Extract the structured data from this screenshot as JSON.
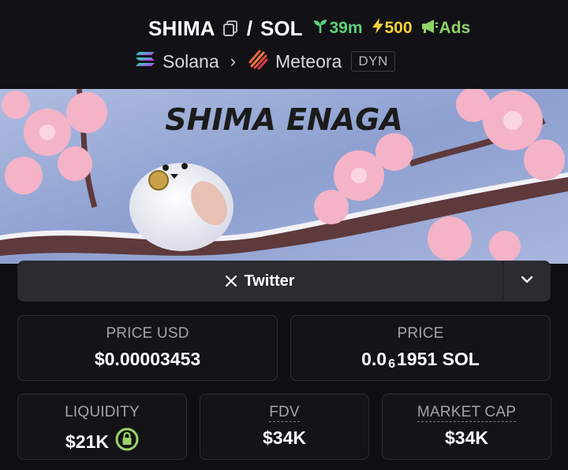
{
  "pair": {
    "base": "SHIMA",
    "separator": "/",
    "quote": "SOL",
    "age": "39m",
    "boosts": "500",
    "ads_label": "Ads"
  },
  "breadcrumb": {
    "chain": "Solana",
    "dex": "Meteora",
    "pool_type": "DYN"
  },
  "banner": {
    "title": "SHIMA ENAGA"
  },
  "socials": {
    "twitter_label": "Twitter"
  },
  "stats": {
    "price_usd_label": "PRICE USD",
    "price_usd_value": "$0.00003453",
    "price_label": "PRICE",
    "price_prefix": "0.0",
    "price_zeros": "6",
    "price_digits": "1951 SOL",
    "liquidity_label": "LIQUIDITY",
    "liquidity_value": "$21K",
    "fdv_label": "FDV",
    "fdv_value": "$34K",
    "mcap_label": "MARKET CAP",
    "mcap_value": "$34K"
  },
  "colors": {
    "background": "#0f0f13",
    "card": "#141418",
    "age_green": "#5fd07a",
    "boost_yellow": "#f5d23d",
    "ads_green": "#8fd36a",
    "lock_green": "#9bd46a"
  },
  "icons": [
    "copy-icon",
    "seedling-icon",
    "bolt-icon",
    "megaphone-icon",
    "solana-icon",
    "chevron-right-icon",
    "meteora-icon",
    "x-logo-icon",
    "chevron-down-icon",
    "lock-icon"
  ]
}
